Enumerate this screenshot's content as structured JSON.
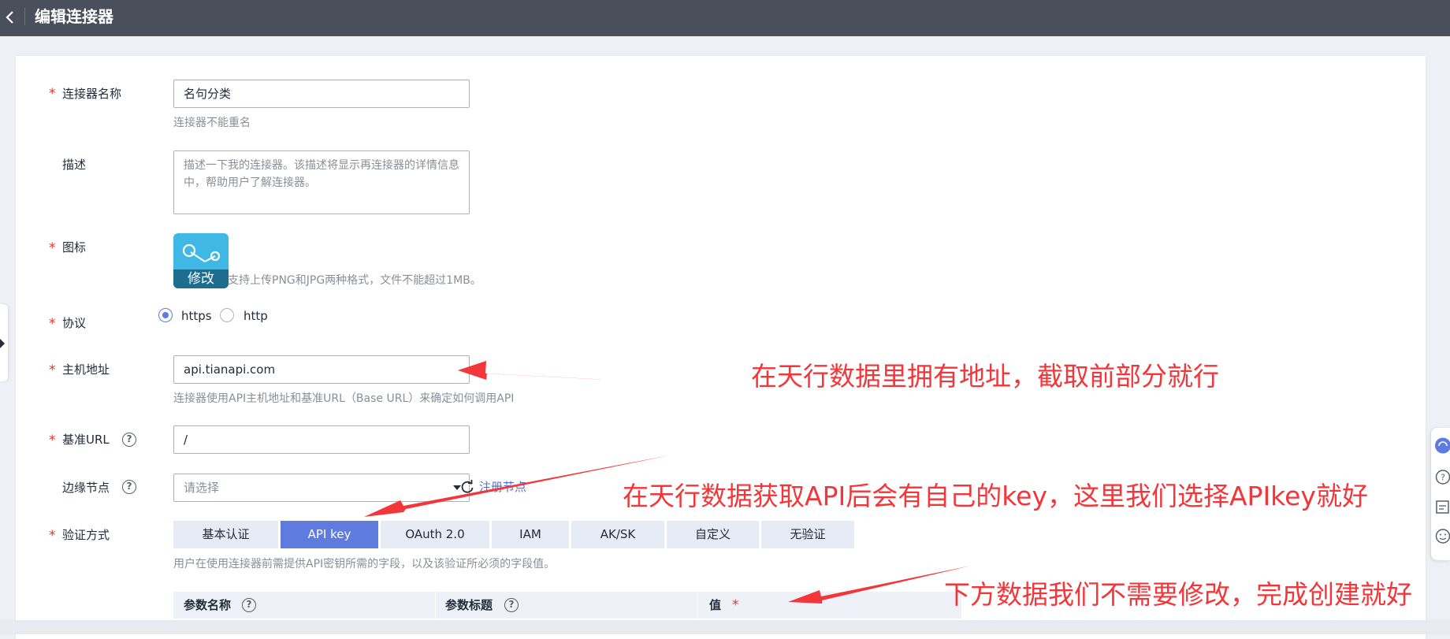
{
  "header": {
    "title": "编辑连接器"
  },
  "form": {
    "name": {
      "label": "连接器名称",
      "value": "名句分类",
      "hint": "连接器不能重名"
    },
    "description": {
      "label": "描述",
      "placeholder": "描述一下我的连接器。该描述将显示再连接器的详情信息中，帮助用户了解连接器。"
    },
    "icon": {
      "label": "图标",
      "edit_label": "修改",
      "hint": "支持上传PNG和JPG两种格式，文件不能超过1MB。"
    },
    "protocol": {
      "label": "协议",
      "options": [
        "https",
        "http"
      ],
      "selected": "https"
    },
    "host": {
      "label": "主机地址",
      "value": "api.tianapi.com",
      "hint": "连接器使用API主机地址和基准URL（Base URL）来确定如何调用API"
    },
    "base_url": {
      "label": "基准URL",
      "value": "/"
    },
    "edge_node": {
      "label": "边缘节点",
      "placeholder": "请选择",
      "link_label": "注册节点"
    },
    "auth": {
      "label": "验证方式",
      "tabs": [
        "基本认证",
        "API key",
        "OAuth 2.0",
        "IAM",
        "AK/SK",
        "自定义",
        "无验证"
      ],
      "active": "API key",
      "hint": "用户在使用连接器前需提供API密钥所需的字段，以及该验证所必须的字段值。"
    },
    "param_table": {
      "headers": [
        "参数名称",
        "参数标题",
        "值"
      ]
    }
  },
  "annotations": {
    "host_note": "在天行数据里拥有地址，截取前部分就行",
    "key_note": "在天行数据获取API后会有自己的key，这里我们选择APIkey就好",
    "table_note": "下方数据我们不需要修改，完成创建就好"
  },
  "colors": {
    "topbar": "#4a4f5c",
    "accent": "#5e7ce0",
    "required": "#e5352c",
    "annotation": "#f2363a",
    "icon_tile": "#3fb8e6"
  }
}
